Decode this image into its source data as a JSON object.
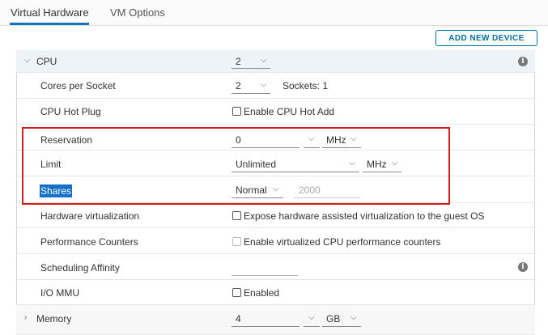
{
  "tabs": [
    {
      "label": "Virtual Hardware",
      "active": true
    },
    {
      "label": "VM Options",
      "active": false
    }
  ],
  "add_device_label": "ADD NEW DEVICE",
  "cpu": {
    "label": "CPU",
    "value": "2",
    "cores_per_socket": {
      "label": "Cores per Socket",
      "value": "2",
      "sockets_text": "Sockets: 1"
    },
    "hot_plug": {
      "label": "CPU Hot Plug",
      "checkbox_label": "Enable CPU Hot Add",
      "checked": false
    },
    "reservation": {
      "label": "Reservation",
      "value": "0",
      "unit": "MHz"
    },
    "limit": {
      "label": "Limit",
      "value": "Unlimited",
      "unit": "MHz"
    },
    "shares": {
      "label": "Shares",
      "level": "Normal",
      "value": "2000"
    },
    "hw_virtualization": {
      "label": "Hardware virtualization",
      "checkbox_label": "Expose hardware assisted virtualization to the guest OS",
      "checked": false
    },
    "perf_counters": {
      "label": "Performance Counters",
      "checkbox_label": "Enable virtualized CPU performance counters",
      "checked": false,
      "disabled": true
    },
    "scheduling_affinity": {
      "label": "Scheduling Affinity",
      "value": ""
    },
    "io_mmu": {
      "label": "I/O MMU",
      "checkbox_label": "Enabled",
      "checked": false
    }
  },
  "memory": {
    "label": "Memory",
    "value": "4",
    "unit": "GB"
  },
  "colors": {
    "accent": "#0072a3",
    "highlight_border": "#d11f1f",
    "selection": "#1670c7"
  }
}
